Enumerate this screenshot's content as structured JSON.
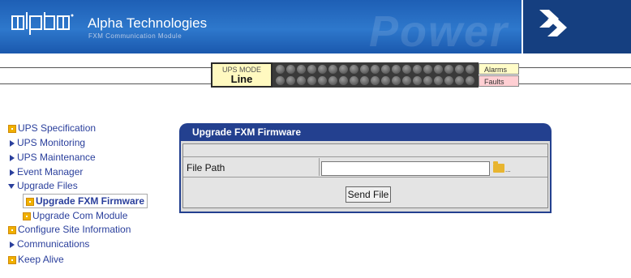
{
  "header": {
    "company": "Alpha Technologies",
    "subtitle": "FXM Communication Module",
    "watermark": "Power"
  },
  "status": {
    "mode_label": "UPS MODE",
    "mode_value": "Line",
    "alarms_label": "Alarms",
    "faults_label": "Faults"
  },
  "sidebar": {
    "items": [
      {
        "label": "UPS Specification"
      },
      {
        "label": "UPS Monitoring"
      },
      {
        "label": "UPS Maintenance"
      },
      {
        "label": "Event Manager"
      },
      {
        "label": "Upgrade Files"
      },
      {
        "label": "Upgrade FXM Firmware"
      },
      {
        "label": "Upgrade Com Module"
      },
      {
        "label": "Configure Site Information"
      },
      {
        "label": "Communications"
      },
      {
        "label": "Keep Alive"
      }
    ]
  },
  "panel": {
    "title": "Upgrade FXM Firmware",
    "file_path_label": "File Path",
    "file_path_value": "",
    "browse_dots": "...",
    "send_label": "Send File"
  },
  "colors": {
    "banner_blue": "#2e78cc",
    "panel_header": "#23408f",
    "nav_text": "#2a3f9c",
    "mode_bg": "#fff9c0",
    "faults_bg": "#ffcfd3"
  }
}
